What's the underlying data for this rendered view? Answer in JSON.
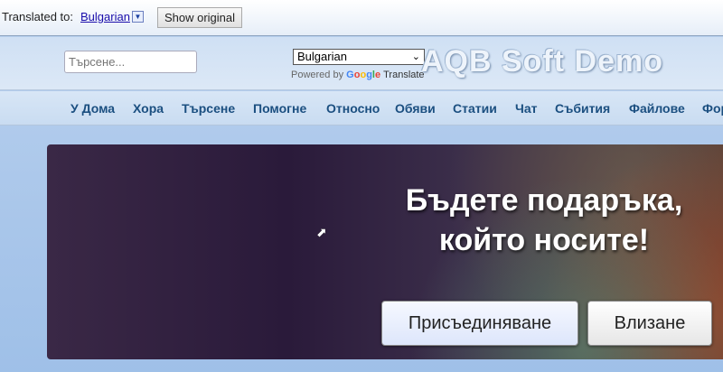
{
  "translate_bar": {
    "label": "Translated to:",
    "language": "Bulgarian",
    "dropdown_icon": "▼",
    "show_original": "Show original"
  },
  "header": {
    "search_placeholder": "Търсене...",
    "language_select": "Bulgarian",
    "powered_by": "Powered by",
    "google": "Google",
    "translate": "Translate",
    "logo": "AQB Soft Demo"
  },
  "nav": [
    "У Дома",
    "Хора",
    "Търсене",
    "Помогне",
    "Относно",
    "Обяви",
    "Статии",
    "Чат",
    "Събития",
    "Файлове",
    "Форуми"
  ],
  "hero": {
    "line1": "Бъдете подаръка,",
    "line2": "който носите!",
    "join": "Присъединяване",
    "login": "Влизане"
  }
}
